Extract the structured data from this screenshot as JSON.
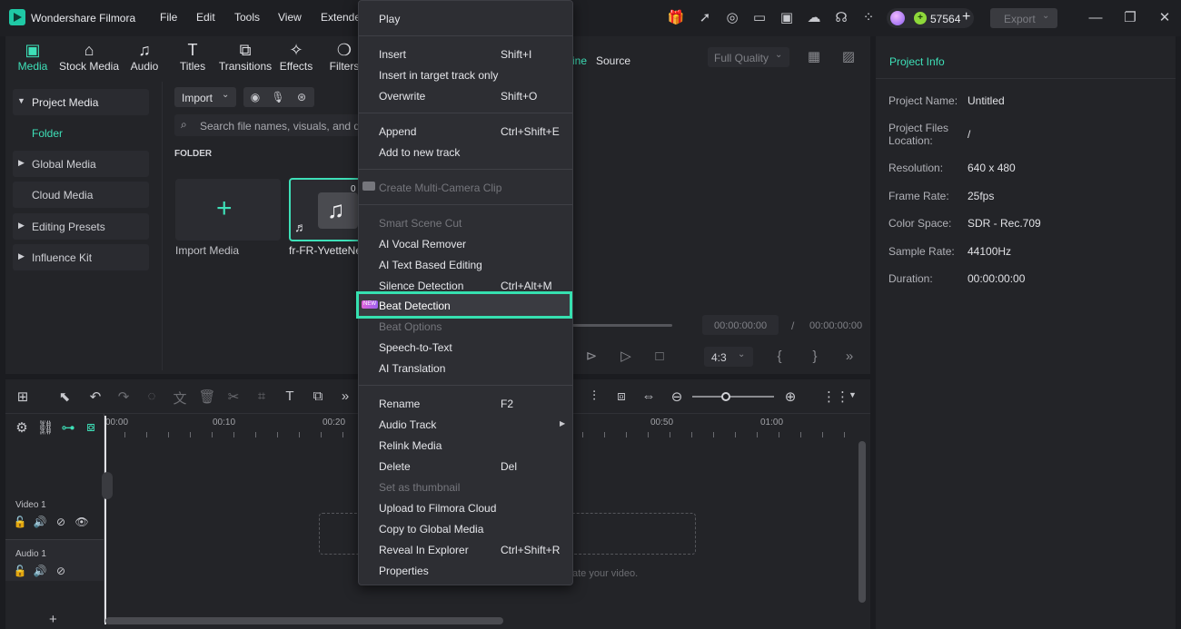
{
  "app": {
    "title": "Wondershare Filmora"
  },
  "menubar": {
    "items": [
      "File",
      "Edit",
      "Tools",
      "View",
      "Extende"
    ]
  },
  "topbar": {
    "credits": "57564",
    "export_label": "Export"
  },
  "media_tabs": [
    {
      "label": "Media",
      "icon": "media-icon"
    },
    {
      "label": "Stock Media",
      "icon": "stock-media-icon"
    },
    {
      "label": "Audio",
      "icon": "music-note-icon"
    },
    {
      "label": "Titles",
      "icon": "titles-icon"
    },
    {
      "label": "Transitions",
      "icon": "transitions-icon"
    },
    {
      "label": "Effects",
      "icon": "effects-icon"
    },
    {
      "label": "Filters",
      "icon": "filters-icon"
    }
  ],
  "sidebar": {
    "project_media": "Project Media",
    "folder": "Folder",
    "global_media": "Global Media",
    "cloud_media": "Cloud Media",
    "editing_presets": "Editing Presets",
    "influence_kit": "Influence Kit"
  },
  "media_panel": {
    "import_label": "Import",
    "search_placeholder": "Search file names, visuals, and dial",
    "folder_header": "FOLDER",
    "import_media_label": "Import Media",
    "clip_name": "fr-FR-YvetteNe",
    "clip_duration": "0"
  },
  "player": {
    "tab_timeline": "ine",
    "tab_source": "Source",
    "quality": "Full Quality",
    "current_time": "00:00:00:00",
    "total_time": "00:00:00:00",
    "separator": "/",
    "ratio": "4:3"
  },
  "project_info": {
    "title": "Project Info",
    "rows": [
      {
        "label": "Project Name:",
        "value": "Untitled"
      },
      {
        "label": "Project Files Location:",
        "value": "/"
      },
      {
        "label": "Resolution:",
        "value": "640 x 480"
      },
      {
        "label": "Frame Rate:",
        "value": "25fps"
      },
      {
        "label": "Color Space:",
        "value": "SDR - Rec.709"
      },
      {
        "label": "Sample Rate:",
        "value": "44100Hz"
      },
      {
        "label": "Duration:",
        "value": "00:00:00:00"
      }
    ]
  },
  "timeline": {
    "ruler": [
      "00:00",
      "00:10",
      "00:20",
      "00:50",
      "01:00"
    ],
    "video_track": "Video 1",
    "audio_track": "Audio 1",
    "hint": "ate your video."
  },
  "context_menu": {
    "play": "Play",
    "insert": "Insert",
    "insert_sc": "Shift+I",
    "insert_target": "Insert in target track only",
    "overwrite": "Overwrite",
    "overwrite_sc": "Shift+O",
    "append": "Append",
    "append_sc": "Ctrl+Shift+E",
    "add_new_track": "Add to new track",
    "multicam": "Create Multi-Camera Clip",
    "smart_scene": "Smart Scene Cut",
    "ai_vocal": "AI Vocal Remover",
    "ai_text": "AI Text Based Editing",
    "silence": "Silence Detection",
    "silence_sc": "Ctrl+Alt+M",
    "beat_badge": "NEW",
    "beat": "Beat Detection",
    "beat_options": "Beat Options",
    "speech": "Speech-to-Text",
    "ai_translation": "AI Translation",
    "rename": "Rename",
    "rename_sc": "F2",
    "audio_track": "Audio Track",
    "relink": "Relink Media",
    "delete": "Delete",
    "delete_sc": "Del",
    "thumbnail": "Set as thumbnail",
    "upload": "Upload to Filmora Cloud",
    "copy_global": "Copy to Global Media",
    "reveal": "Reveal In Explorer",
    "reveal_sc": "Ctrl+Shift+R",
    "properties": "Properties"
  },
  "colors": {
    "accent": "#3ee0b8",
    "highlight_border": "#36e0b0"
  }
}
